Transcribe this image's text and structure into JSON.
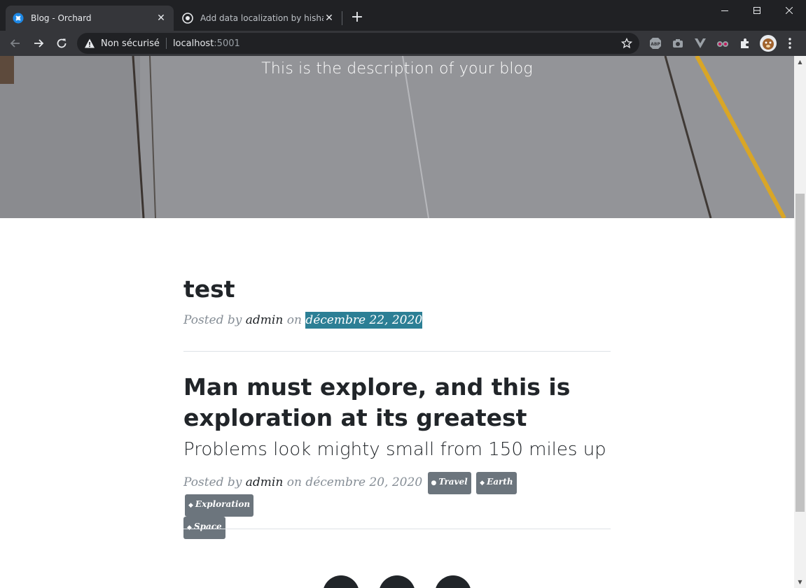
{
  "browser": {
    "tabs": [
      {
        "title": "Blog - Orchard",
        "active": true,
        "icon": "orchard-icon"
      },
      {
        "title": "Add data localization by hishamc",
        "active": false,
        "icon": "github-icon"
      }
    ],
    "address": {
      "security_label": "Non sécurisé",
      "host": "localhost",
      "port": ":5001"
    },
    "extensions": [
      "abp-icon",
      "camera-icon",
      "vue-devtools-icon",
      "binoculars-icon",
      "puzzle-icon",
      "avatar",
      "menu-icon"
    ]
  },
  "hero": {
    "description": "This is the description of your blog"
  },
  "posts": [
    {
      "title": "test",
      "meta_prefix": "Posted by",
      "author": "admin",
      "meta_on": "on",
      "date": "décembre 22, 2020"
    },
    {
      "title_line1": "Man must explore, and this is",
      "title_line2": "exploration at its greatest",
      "subtitle": "Problems look mighty small from 150 miles up",
      "meta_prefix": "Posted by",
      "author": "admin",
      "meta_on": "on",
      "date": "décembre 20, 2020",
      "tags": [
        {
          "label": "Travel",
          "icon": "globe-icon"
        },
        {
          "label": "Earth",
          "icon": "tag-icon"
        },
        {
          "label": "Exploration",
          "icon": "tag-icon"
        },
        {
          "label": "Space",
          "icon": "tag-icon"
        }
      ]
    }
  ],
  "footer": {
    "social": [
      "twitter-icon",
      "facebook-icon",
      "github-icon"
    ]
  },
  "colors": {
    "selection": "#2c7f95",
    "tag_bg": "#6c757d",
    "heading": "#212529",
    "meta": "#868e96"
  }
}
